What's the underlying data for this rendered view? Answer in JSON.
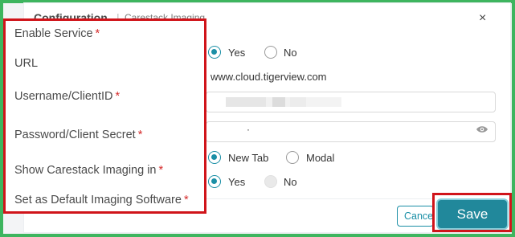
{
  "modal": {
    "title": "Configuration",
    "separator": "|",
    "subtitle": "Carestack Imaging",
    "close_glyph": "×"
  },
  "labels": {
    "enable_service": "Enable Service",
    "url": "URL",
    "username": "Username/ClientID",
    "password": "Password/Client Secret",
    "show_in": "Show Carestack Imaging in",
    "default_software": "Set as Default Imaging Software",
    "required_mark": "*"
  },
  "enable_service": {
    "yes": "Yes",
    "no": "No",
    "selected": "Yes"
  },
  "url_value": "www.cloud.tigerview.com",
  "username_value": "",
  "password_value": "·",
  "show_in": {
    "new_tab": "New Tab",
    "modal": "Modal",
    "selected": "New Tab"
  },
  "default_software": {
    "yes": "Yes",
    "no": "No",
    "selected": "Yes"
  },
  "buttons": {
    "cancel": "Cancel",
    "save": "Save"
  },
  "icons": {
    "close": "close-icon",
    "eye": "eye-icon"
  },
  "colors": {
    "accent": "#1a8fa6",
    "save_bg": "#21889b",
    "highlight": "#d0141a",
    "required": "#d52b2b",
    "frame": "#3eb55f"
  }
}
